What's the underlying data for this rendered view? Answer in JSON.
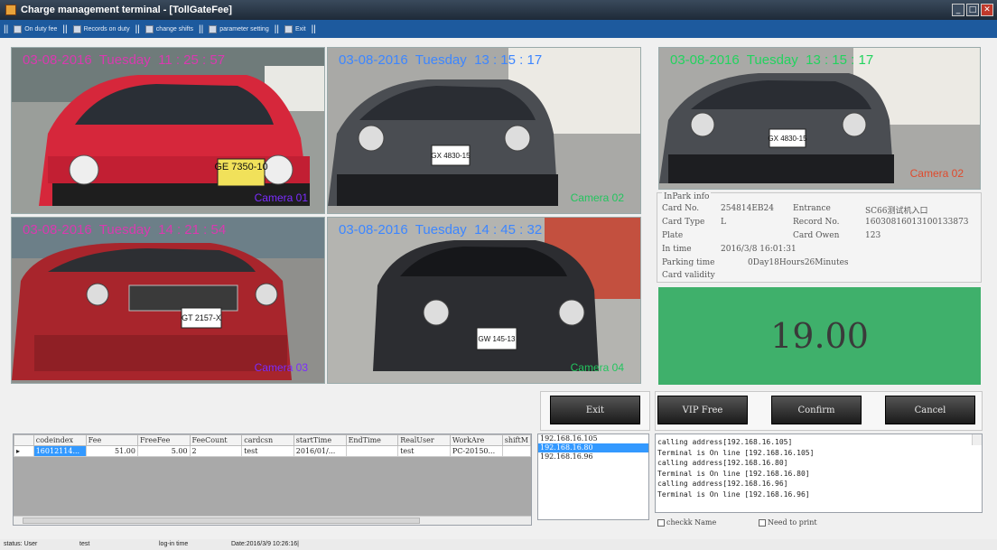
{
  "window": {
    "title": "Charge management terminal - [TollGateFee]",
    "controls": [
      "_",
      "□",
      "✕"
    ]
  },
  "menu": {
    "items": [
      {
        "label": "On duty fee"
      },
      {
        "label": "Records on duty"
      },
      {
        "label": "change shifts"
      },
      {
        "label": "parameter setting"
      },
      {
        "label": "Exit"
      }
    ]
  },
  "cameras": [
    {
      "timestamp": "03-08-2016  Tuesday  11 : 25 : 57",
      "label": "Camera 01",
      "plate": "GE 7350-10"
    },
    {
      "timestamp": "03-08-2016  Tuesday  13 : 15 : 17",
      "label": "Camera 02",
      "plate": "GX 4830-15"
    },
    {
      "timestamp": "03-08-2016  Tuesday  14 : 21 : 54",
      "label": "Camera 03",
      "plate": "GT 2157-X"
    },
    {
      "timestamp": "03-08-2016  Tuesday  14 : 45 : 32",
      "label": "Camera 04",
      "plate": "GW 145-13"
    }
  ],
  "main_camera": {
    "timestamp": "03-08-2016  Tuesday  13 : 15 : 17",
    "label": "Camera 02",
    "plate": "GX 4830-15"
  },
  "inpark": {
    "legend": "InPark info",
    "card_no_label": "Card No.",
    "card_no": "254814EB24",
    "entrance_label": "Entrance",
    "entrance": "SC66测试机入口",
    "card_type_label": "Card Type",
    "card_type": "L",
    "record_no_label": "Record No.",
    "record_no": "16030816013100133873",
    "plate_label": "Plate",
    "plate": "",
    "card_owner_label": "Card Owen",
    "card_owner": "123",
    "in_time_label": "In time",
    "in_time": "2016/3/8 16:01:31",
    "parking_time_label": "Parking time",
    "parking_time": "0Day18Hours26Minutes",
    "card_validity_label": "Card validity",
    "card_validity": ""
  },
  "fee": {
    "amount": "19.00",
    "color": "#3fb06b"
  },
  "buttons": {
    "exit": "Exit",
    "vip_free": "VIP Free",
    "confirm": "Confirm",
    "cancel": "Cancel"
  },
  "grid": {
    "columns": [
      "codeindex",
      "Fee",
      "FreeFee",
      "FeeCount",
      "cardcsn",
      "startTime",
      "EndTime",
      "RealUser",
      "WorkAre",
      "shiftM"
    ],
    "rows": [
      [
        "16012114...",
        "51.00",
        "5.00",
        "2",
        "test",
        "2016/01/...",
        "",
        "test",
        "PC-20150...",
        ""
      ]
    ]
  },
  "ip_list": {
    "items": [
      "192.168.16.105",
      "192.168.16.80",
      "192.168.16.96"
    ],
    "selected": 1
  },
  "log": {
    "lines": [
      "calling address[192.168.16.105]",
      "Terminal is On line [192.168.16.105]",
      "calling address[192.168.16.80]",
      "Terminal is On line [192.168.16.80]",
      "calling address[192.168.16.96]",
      "Terminal is On line [192.168.16.96]"
    ]
  },
  "checkboxes": {
    "check_name": "checkk Name",
    "need_print": "Need to print"
  },
  "status": {
    "status_label": "status: User",
    "user": "test",
    "login_label": "log-in time",
    "date": "Date:2016/3/9 10:26:16|"
  }
}
